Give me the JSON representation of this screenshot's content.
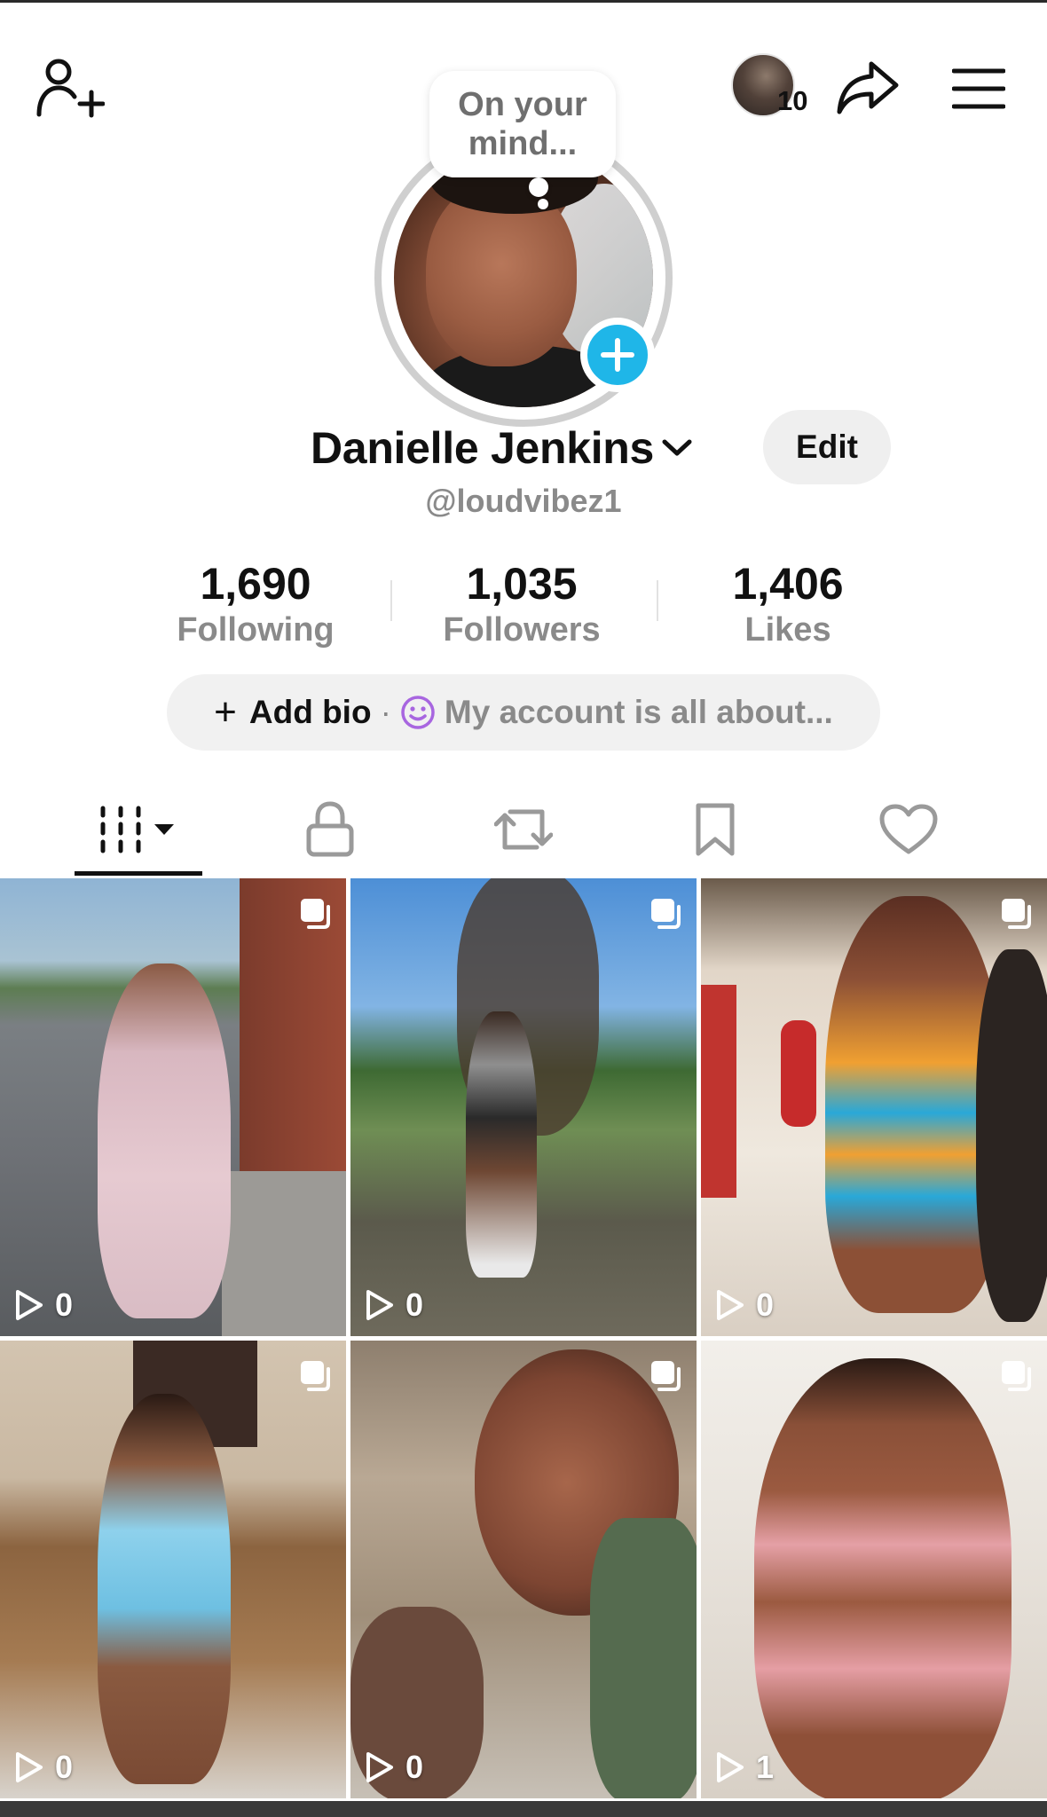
{
  "header": {
    "add_friend_icon": "person-plus-icon",
    "visitor_count": "10",
    "share_icon": "share-arrow-icon",
    "menu_icon": "hamburger-menu-icon"
  },
  "profile": {
    "bubble_text": "On your mind...",
    "display_name": "Danielle Jenkins",
    "handle": "@loudvibez1",
    "edit_label": "Edit"
  },
  "stats": [
    {
      "value": "1,690",
      "label": "Following"
    },
    {
      "value": "1,035",
      "label": "Followers"
    },
    {
      "value": "1,406",
      "label": "Likes"
    }
  ],
  "bio": {
    "add_label": "Add bio",
    "separator": "·",
    "placeholder": "My account is all about..."
  },
  "tabs": [
    {
      "name": "videos",
      "icon": "grid-bars-icon",
      "selected": true
    },
    {
      "name": "private",
      "icon": "lock-icon",
      "selected": false
    },
    {
      "name": "reposts",
      "icon": "repost-icon",
      "selected": false
    },
    {
      "name": "favorites",
      "icon": "bookmark-icon",
      "selected": false
    },
    {
      "name": "liked",
      "icon": "heart-icon",
      "selected": false
    }
  ],
  "videos": [
    {
      "views": "0"
    },
    {
      "views": "0"
    },
    {
      "views": "0"
    },
    {
      "views": "0"
    },
    {
      "views": "0"
    },
    {
      "views": "1"
    }
  ],
  "colors": {
    "accent_blue": "#1fb6e8",
    "muted_text": "#8a8a8a",
    "pill_bg": "#f1f1f1"
  }
}
